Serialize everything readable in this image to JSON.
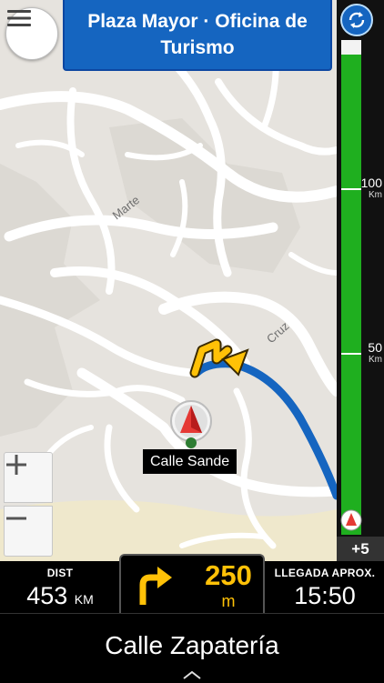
{
  "destination": {
    "title": "Plaza Mayor · Oficina de Turismo"
  },
  "map": {
    "current_street_label": "Calle Sande",
    "street_names": [
      "Marte",
      "Cruz"
    ]
  },
  "route_progress": {
    "completed_fraction": 0.97,
    "marks": [
      {
        "value": "100",
        "unit": "Km"
      },
      {
        "value": "50",
        "unit": "Km"
      }
    ],
    "time_difference": "+5"
  },
  "bottom_bar": {
    "distance": {
      "label": "DIST",
      "value": "453",
      "unit": "KM"
    },
    "next_turn": {
      "distance": "250",
      "unit": "m",
      "direction": "turn-right"
    },
    "eta": {
      "label": "LLEGADA APROX.",
      "value": "15:50"
    }
  },
  "next_street": "Calle Zapatería",
  "icons": {
    "menu": "hamburger-icon",
    "refresh": "refresh-icon",
    "zoom_in": "plus-icon",
    "zoom_out": "minus-icon",
    "turn": "turn-right-arrow-icon",
    "expand": "chevron-up-icon"
  },
  "colors": {
    "route": "#1565c0",
    "progress": "#1faf1f",
    "turn_accent": "#ffc107",
    "banner": "#1565c0"
  }
}
